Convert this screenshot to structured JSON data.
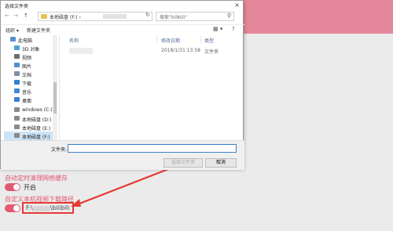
{
  "dialog": {
    "title": "选择文件夹",
    "close_glyph": "×",
    "address": {
      "path": "本地磁盘 (F:) ›",
      "dropdown_glyph": "⌄",
      "refresh_glyph": "↻"
    },
    "search_placeholder": "搜索\"bilibili\"",
    "search_glyph": "⚲",
    "nav_buttons": {
      "back": "←",
      "forward": "→",
      "up": "↑"
    },
    "commands": {
      "organize": "组织 ▾",
      "new_folder": "新建文件夹"
    },
    "command_icons": {
      "view": "▦ ▾",
      "help": "?"
    },
    "sidebar": [
      {
        "label": "此电脑",
        "icon": "computer-icon",
        "color": "#5a8fd0"
      },
      {
        "label": "3D 对象",
        "icon": "cube-icon",
        "color": "#4aa3df"
      },
      {
        "label": "视频",
        "icon": "video-icon",
        "color": "#6d6d6d"
      },
      {
        "label": "图片",
        "icon": "picture-icon",
        "color": "#4f8fcf"
      },
      {
        "label": "文档",
        "icon": "document-icon",
        "color": "#7d8ea3"
      },
      {
        "label": "下载",
        "icon": "download-icon",
        "color": "#2f7fd6"
      },
      {
        "label": "音乐",
        "icon": "music-icon",
        "color": "#3f86d9"
      },
      {
        "label": "桌面",
        "icon": "desktop-icon",
        "color": "#3d7ecb"
      },
      {
        "label": "windows (C:)",
        "icon": "drive-icon",
        "color": "#8a8a8a"
      },
      {
        "label": "本地磁盘 (D:)",
        "icon": "drive-icon",
        "color": "#8a8a8a"
      },
      {
        "label": "本地磁盘 (E:)",
        "icon": "drive-icon",
        "color": "#8a8a8a"
      },
      {
        "label": "本地磁盘 (F:)",
        "icon": "drive-icon",
        "color": "#8a8a8a",
        "selected": true
      }
    ],
    "columns": {
      "name": "名称",
      "modified": "修改日期",
      "type": "类型"
    },
    "files": [
      {
        "modified": "2018/1/31 13:58",
        "type": "文件夹"
      }
    ],
    "filename_label": "文件夹:",
    "select_button": "选择文件夹",
    "cancel_button": "取消"
  },
  "settings": {
    "auto_clear_label": "自动定时清理网络缓存",
    "auto_clear_toggle_text": "开启",
    "custom_path_label": "自定义本机视频下载路径",
    "custom_path_value": "F:\\",
    "custom_path_suffix": "\\bilibili"
  },
  "colors": {
    "accent_pink": "#e05a73",
    "annotation_red": "#e53935",
    "header_pink": "#e5879b"
  }
}
